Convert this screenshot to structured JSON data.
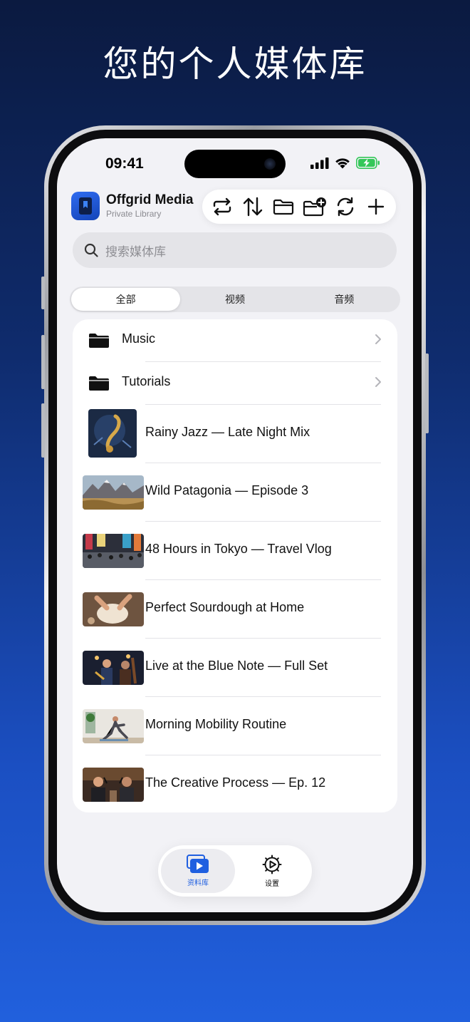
{
  "headline": "您的个人媒体库",
  "status_bar": {
    "time": "09:41"
  },
  "app": {
    "title": "Offgrid Media",
    "subtitle": "Private Library"
  },
  "toolbar": {
    "icons": [
      "repeat-icon",
      "sort-icon",
      "folder-icon",
      "new-folder-icon",
      "refresh-icon",
      "plus-icon"
    ]
  },
  "search": {
    "placeholder": "搜索媒体库"
  },
  "segments": {
    "all": "全部",
    "video": "视频",
    "audio": "音频",
    "selected": "全部"
  },
  "folders": [
    {
      "name": "Music"
    },
    {
      "name": "Tutorials"
    }
  ],
  "media": [
    {
      "title": "Rainy Jazz — Late Night Mix",
      "kind": "audio"
    },
    {
      "title": "Wild Patagonia — Episode 3",
      "kind": "video"
    },
    {
      "title": "48 Hours in Tokyo — Travel Vlog",
      "kind": "video"
    },
    {
      "title": "Perfect Sourdough at Home",
      "kind": "video"
    },
    {
      "title": "Live at the Blue Note — Full Set",
      "kind": "video"
    },
    {
      "title": "Morning Mobility Routine",
      "kind": "video"
    },
    {
      "title": "The Creative Process — Ep. 12",
      "kind": "video"
    }
  ],
  "tabbar": {
    "library": "资料库",
    "settings": "设置",
    "selected": "资料库"
  },
  "colors": {
    "accent": "#1f5fe0",
    "background_top": "#0b1a40",
    "background_bottom": "#2160dd"
  }
}
